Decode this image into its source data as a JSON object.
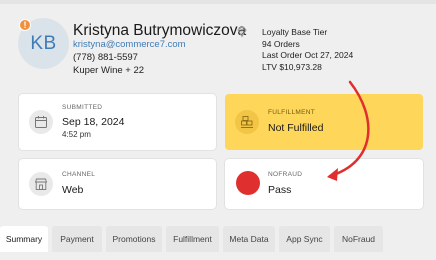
{
  "customer": {
    "initials": "KB",
    "alert_badge": "!",
    "name": "Kristyna Butrymowiczova",
    "email": "kristyna@commerce7.com",
    "phone": "(778) 881-5597",
    "club": "Kuper Wine + 22",
    "icons": {
      "avatar": "avatar-initials",
      "alert": "alert-badge-icon",
      "tier": "diamond-icon"
    }
  },
  "stats": {
    "tier": "Loyalty Base Tier",
    "orders": "94 Orders",
    "last_order": "Last Order Oct 27, 2024",
    "ltv": "LTV  $10,973.28"
  },
  "cards": {
    "submitted": {
      "label": "SUBMITTED",
      "value": "Sep 18, 2024",
      "sub": "4:52 pm",
      "icon": "calendar-icon"
    },
    "fulfillment": {
      "label": "FULFILLMENT",
      "value": "Not Fulfilled",
      "icon": "boxes-icon",
      "bg": "#fdd65a"
    },
    "channel": {
      "label": "CHANNEL",
      "value": "Web",
      "icon": "storefront-icon"
    },
    "nofraud": {
      "label": "NOFRAUD",
      "value": "Pass",
      "icon": "red-status-dot",
      "status_color": "#e02f2f"
    }
  },
  "tabs": [
    {
      "label": "Summary",
      "active": true
    },
    {
      "label": "Payment"
    },
    {
      "label": "Promotions"
    },
    {
      "label": "Fulfillment"
    },
    {
      "label": "Meta Data"
    },
    {
      "label": "App Sync"
    },
    {
      "label": "NoFraud"
    }
  ],
  "colors": {
    "accent": "#3f7cb6",
    "annotation_arrow": "#e02f2f",
    "alert": "#f0913f"
  }
}
